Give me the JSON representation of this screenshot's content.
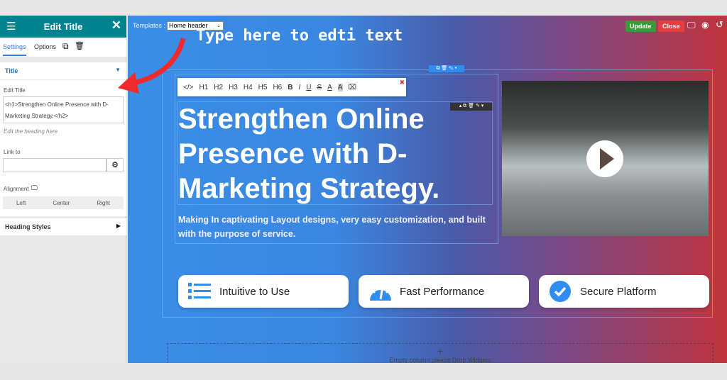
{
  "sidebar": {
    "title": "Edit Title",
    "tabs": [
      "Settings",
      "Options"
    ],
    "section_title": "Title",
    "edit_title_label": "Edit Title",
    "edit_title_value": "<h1>Strengthen Online Presence with D-Marketing Strategy.</h2>",
    "edit_hint": "Edit the heading here",
    "link_label": "Link to",
    "link_value": "",
    "alignment_label": "Alignment",
    "alignment_options": [
      "Left",
      "Center",
      "Right"
    ],
    "heading_styles": "Heading Styles"
  },
  "topbar": {
    "templates_label": "Templates :",
    "templates_value": "Home header",
    "update": "Update",
    "close": "Close"
  },
  "annotation": "Type here to edti text",
  "toolbar": [
    "</>",
    "H1",
    "H2",
    "H3",
    "H4",
    "H5",
    "H6",
    "B",
    "I",
    "U",
    "S",
    "A",
    "A"
  ],
  "hero": {
    "title": "Strengthen Online Presence with D-Marketing Strategy.",
    "subtitle": "Making In captivating Layout designs, very easy customization, and built with the purpose of service."
  },
  "features": [
    {
      "label": "Intuitive to Use",
      "icon": "list-icon"
    },
    {
      "label": "Fast Performance",
      "icon": "speedometer-icon"
    },
    {
      "label": "Secure Platform",
      "icon": "check-circle-icon"
    }
  ],
  "empty_column": "Empty column please Drop Widgets",
  "colors": {
    "header": "#00838f",
    "update": "#3a9a3a",
    "close": "#e53e3e",
    "accent": "#2f8cf0",
    "arrow": "#f02a2a"
  }
}
